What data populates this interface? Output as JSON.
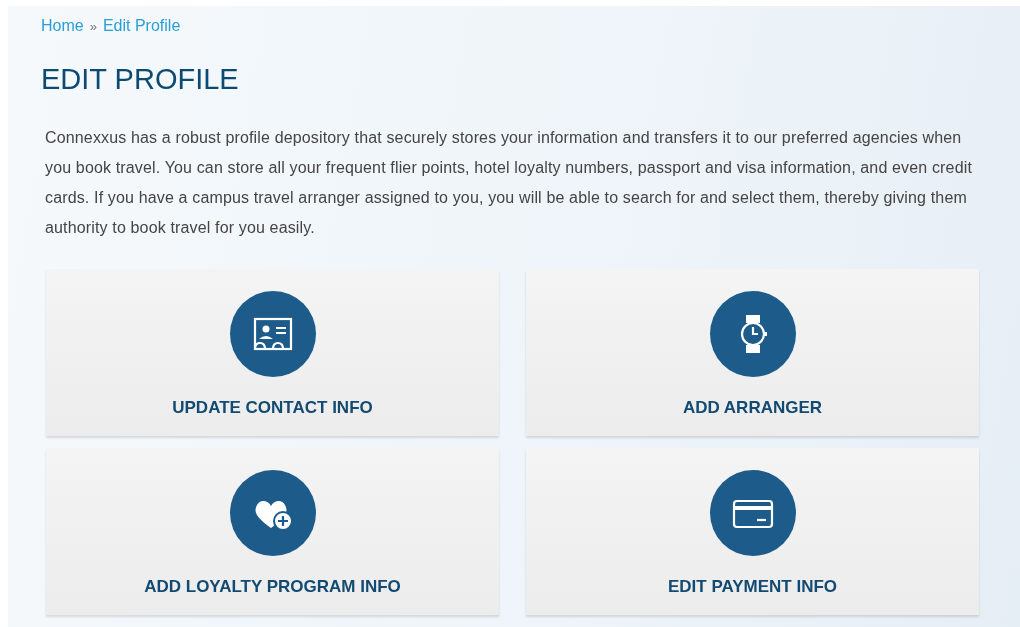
{
  "breadcrumb": [
    {
      "label": "Home"
    },
    {
      "label": "»",
      "kind": "separator"
    },
    {
      "label": "Edit Profile"
    }
  ],
  "title": "EDIT PROFILE",
  "intro": "Connexxus has a robust profile depository that securely stores your information and transfers it to our preferred agencies when you book travel. You can store all your frequent flier points, hotel loyalty numbers, passport and visa information, and even credit cards. If you have a campus travel arranger assigned to you, you will be able to search for and select them, thereby giving them authority to book travel for you easily.",
  "tiles": [
    {
      "label": "UPDATE CONTACT INFO",
      "kind": "contact"
    },
    {
      "label": "ADD ARRANGER",
      "kind": "watch"
    },
    {
      "label": "ADD LOYALTY PROGRAM INFO",
      "kind": "loyalty"
    },
    {
      "label": "EDIT PAYMENT INFO",
      "kind": "card"
    }
  ]
}
